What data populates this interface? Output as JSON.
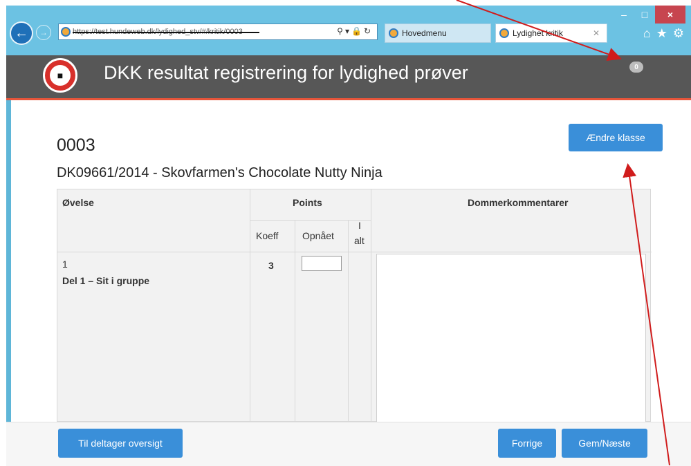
{
  "browser": {
    "address": "https://test.hundeweb.dk/lydighed_stv/#/kritik/0003",
    "tabs": [
      {
        "label": "Hovedmenu",
        "active": false
      },
      {
        "label": "Lydighet kritik",
        "active": true
      }
    ],
    "window_controls": [
      "–",
      "□",
      "×"
    ],
    "toolbar_icons": [
      "home-icon",
      "star-icon",
      "gear-icon"
    ]
  },
  "header": {
    "title": "DKK resultat registrering for lydighed prøver",
    "badge": "0",
    "accent": "#e8553a",
    "background": "#575757"
  },
  "participant": {
    "number": "0003",
    "dog": "DK09661/2014 - Skovfarmen's Chocolate Nutty Ninja"
  },
  "actions": {
    "change_class": "Ændre klasse",
    "overview": "Til deltager oversigt",
    "previous": "Forrige",
    "save_next": "Gem/Næste"
  },
  "table": {
    "headers": {
      "exercise": "Øvelse",
      "points": "Points",
      "comments": "Dommerkommentarer",
      "coeff": "Koeff",
      "achieved": "Opnået",
      "total_line1": "I",
      "total_line2": "alt"
    },
    "rows": [
      {
        "number": "1",
        "name": "Del 1 – Sit i gruppe",
        "coeff": "3",
        "achieved": "",
        "total": "",
        "comment": ""
      }
    ]
  },
  "colors": {
    "button": "#3a8fd9",
    "browser_chrome": "#6cc2e3",
    "annotation_arrow": "#d01c1c"
  }
}
